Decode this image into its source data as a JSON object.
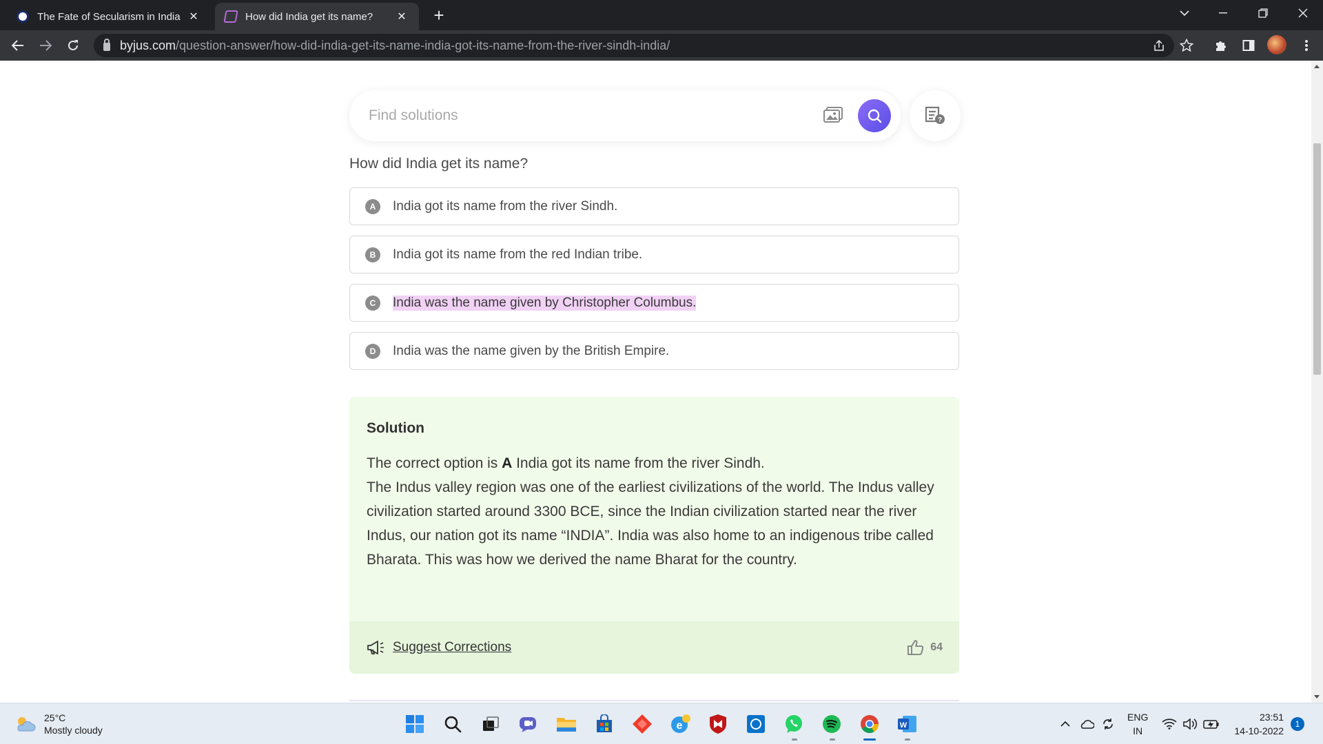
{
  "browser": {
    "tabs": [
      {
        "title": "The Fate of Secularism in India -",
        "active": false
      },
      {
        "title": "How did India get its name?",
        "active": true
      }
    ],
    "new_tab_label": "+",
    "url_domain": "byjus.com",
    "url_path": "/question-answer/how-did-india-get-its-name-india-got-its-name-from-the-river-sindh-india/"
  },
  "search": {
    "placeholder": "Find solutions"
  },
  "question": {
    "text": "How did India get its name?",
    "options": [
      {
        "letter": "A",
        "text": "India got its name from the river Sindh."
      },
      {
        "letter": "B",
        "text": "India got its name from the red Indian tribe."
      },
      {
        "letter": "C",
        "text": "India was the name given by Christopher Columbus."
      },
      {
        "letter": "D",
        "text": "India was the name given by the British Empire."
      }
    ],
    "highlighted_option": "C"
  },
  "solution": {
    "title": "Solution",
    "correct_prefix": "The correct option is ",
    "correct_letter": "A",
    "correct_text": " India got its name from the river Sindh.",
    "body": "The Indus valley region was one of the earliest civilizations of the world. The Indus valley civilization started around 3300 BCE, since the Indian civilization started near the river Indus, our nation got its name “INDIA”. India was also home to an indigenous tribe called Bharata. This was how we derived the name Bharat for the country.",
    "suggest_label": "Suggest Corrections",
    "likes": "64"
  },
  "taskbar": {
    "temperature": "25°C",
    "weather": "Mostly cloudy",
    "language": "ENG",
    "region": "IN",
    "time": "23:51",
    "date": "14-10-2022",
    "notifications": "1"
  },
  "colors": {
    "accent_purple": "#6a57ee",
    "solution_bg": "#f1fbe9",
    "highlight": "#f1d2f5"
  }
}
